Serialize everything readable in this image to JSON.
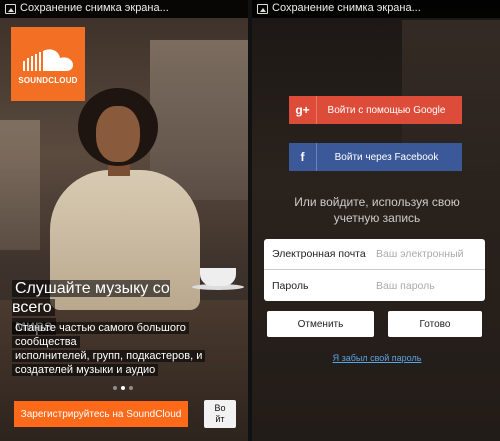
{
  "status_bar": {
    "text": "Сохранение снимка экрана..."
  },
  "welcome": {
    "logo_text": "SOUNDCLOUD",
    "headline_line1": "Слушайте музыку со всего",
    "headline_line2": "мира",
    "sub_line1": "Станьте частью самого большого",
    "sub_line2": "сообщества",
    "sub_line3": "исполнителей, групп, подкастеров, и",
    "sub_line4": "создателей музыки и аудио",
    "register_button": "Зарегистрируйтесь на SoundCloud",
    "login_button_line1": "Во",
    "login_button_line2": "йт",
    "pager_active": 2,
    "pager_count": 3
  },
  "login": {
    "google_icon": "g+",
    "google_button": "Войти с помощью Google",
    "facebook_icon": "f",
    "facebook_button": "Войти через Facebook",
    "or_line1": "Или войдите, используя свою",
    "or_line2": "учетную запись",
    "email_label": "Электронная почта",
    "email_placeholder": "Ваш электронный",
    "password_label": "Пароль",
    "password_placeholder": "Ваш пароль",
    "cancel_button": "Отменить",
    "done_button": "Готово",
    "forgot_link": "Я забыл свой пароль"
  },
  "colors": {
    "soundcloud_orange": "#f26f23",
    "register_orange": "#ff6a1a",
    "google_red": "#dd4b39",
    "facebook_blue": "#3b5998",
    "link_blue": "#5aa3e6"
  }
}
